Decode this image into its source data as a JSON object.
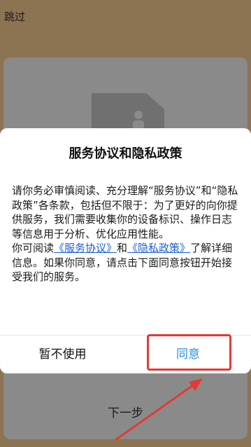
{
  "top": {
    "skip_label": "跳过"
  },
  "background": {
    "next_label": "下一步",
    "icon": "document-person-icon"
  },
  "dialog": {
    "title": "服务协议和隐私政策",
    "para1": "请你务必审慎阅读、充分理解“服务协议”和“隐私政策”各条款，包括但不限于：为了更好的向你提供服务，我们需要收集你的设备标识、操作日志等信息用于分析、优化应用性能。",
    "para2_prefix": "你可阅读",
    "link_service": "《服务协议》",
    "and": "和",
    "link_privacy": "《隐私政策》",
    "para2_suffix": "了解详细信息。如果你同意，请点击下面同意按钮开始接受我们的服务。",
    "decline_label": "暂不使用",
    "agree_label": "同意"
  },
  "colors": {
    "accent": "#2a8fe0",
    "link": "#1a5fd6",
    "annotation": "#e53935"
  }
}
